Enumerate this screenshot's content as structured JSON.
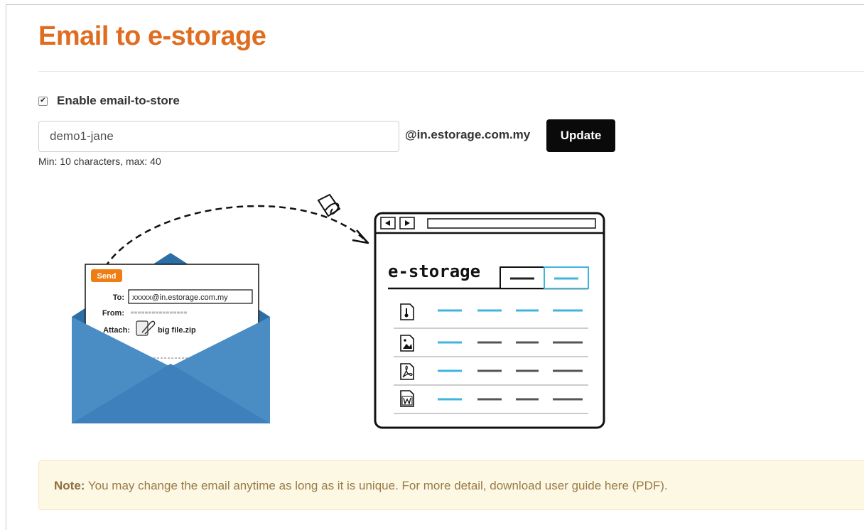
{
  "page": {
    "title": "Email to e-storage"
  },
  "settings": {
    "enable_label": "Enable email-to-store",
    "enabled": true,
    "email_value": "demo1-jane",
    "domain_suffix": "@in.estorage.com.my",
    "update_label": "Update",
    "hint": "Min: 10 characters, max: 40"
  },
  "illustration": {
    "send_badge": "Send",
    "to_label": "To:",
    "to_value": "xxxxx@in.estorage.com.my",
    "from_label": "From:",
    "attach_label": "Attach:",
    "attachment_name": "big file.zip",
    "app_name": "e-storage",
    "envelope_color": "#4a8cc4",
    "accent_blue": "#3fb5de"
  },
  "note": {
    "label": "Note:",
    "text": "You may change the email anytime as long as it is unique. For more detail, download user guide here (PDF)."
  },
  "colors": {
    "title": "#e06d1f",
    "note_bg": "#fcf8e4",
    "note_text": "#9a7a48",
    "button_bg": "#0a0a0a"
  }
}
